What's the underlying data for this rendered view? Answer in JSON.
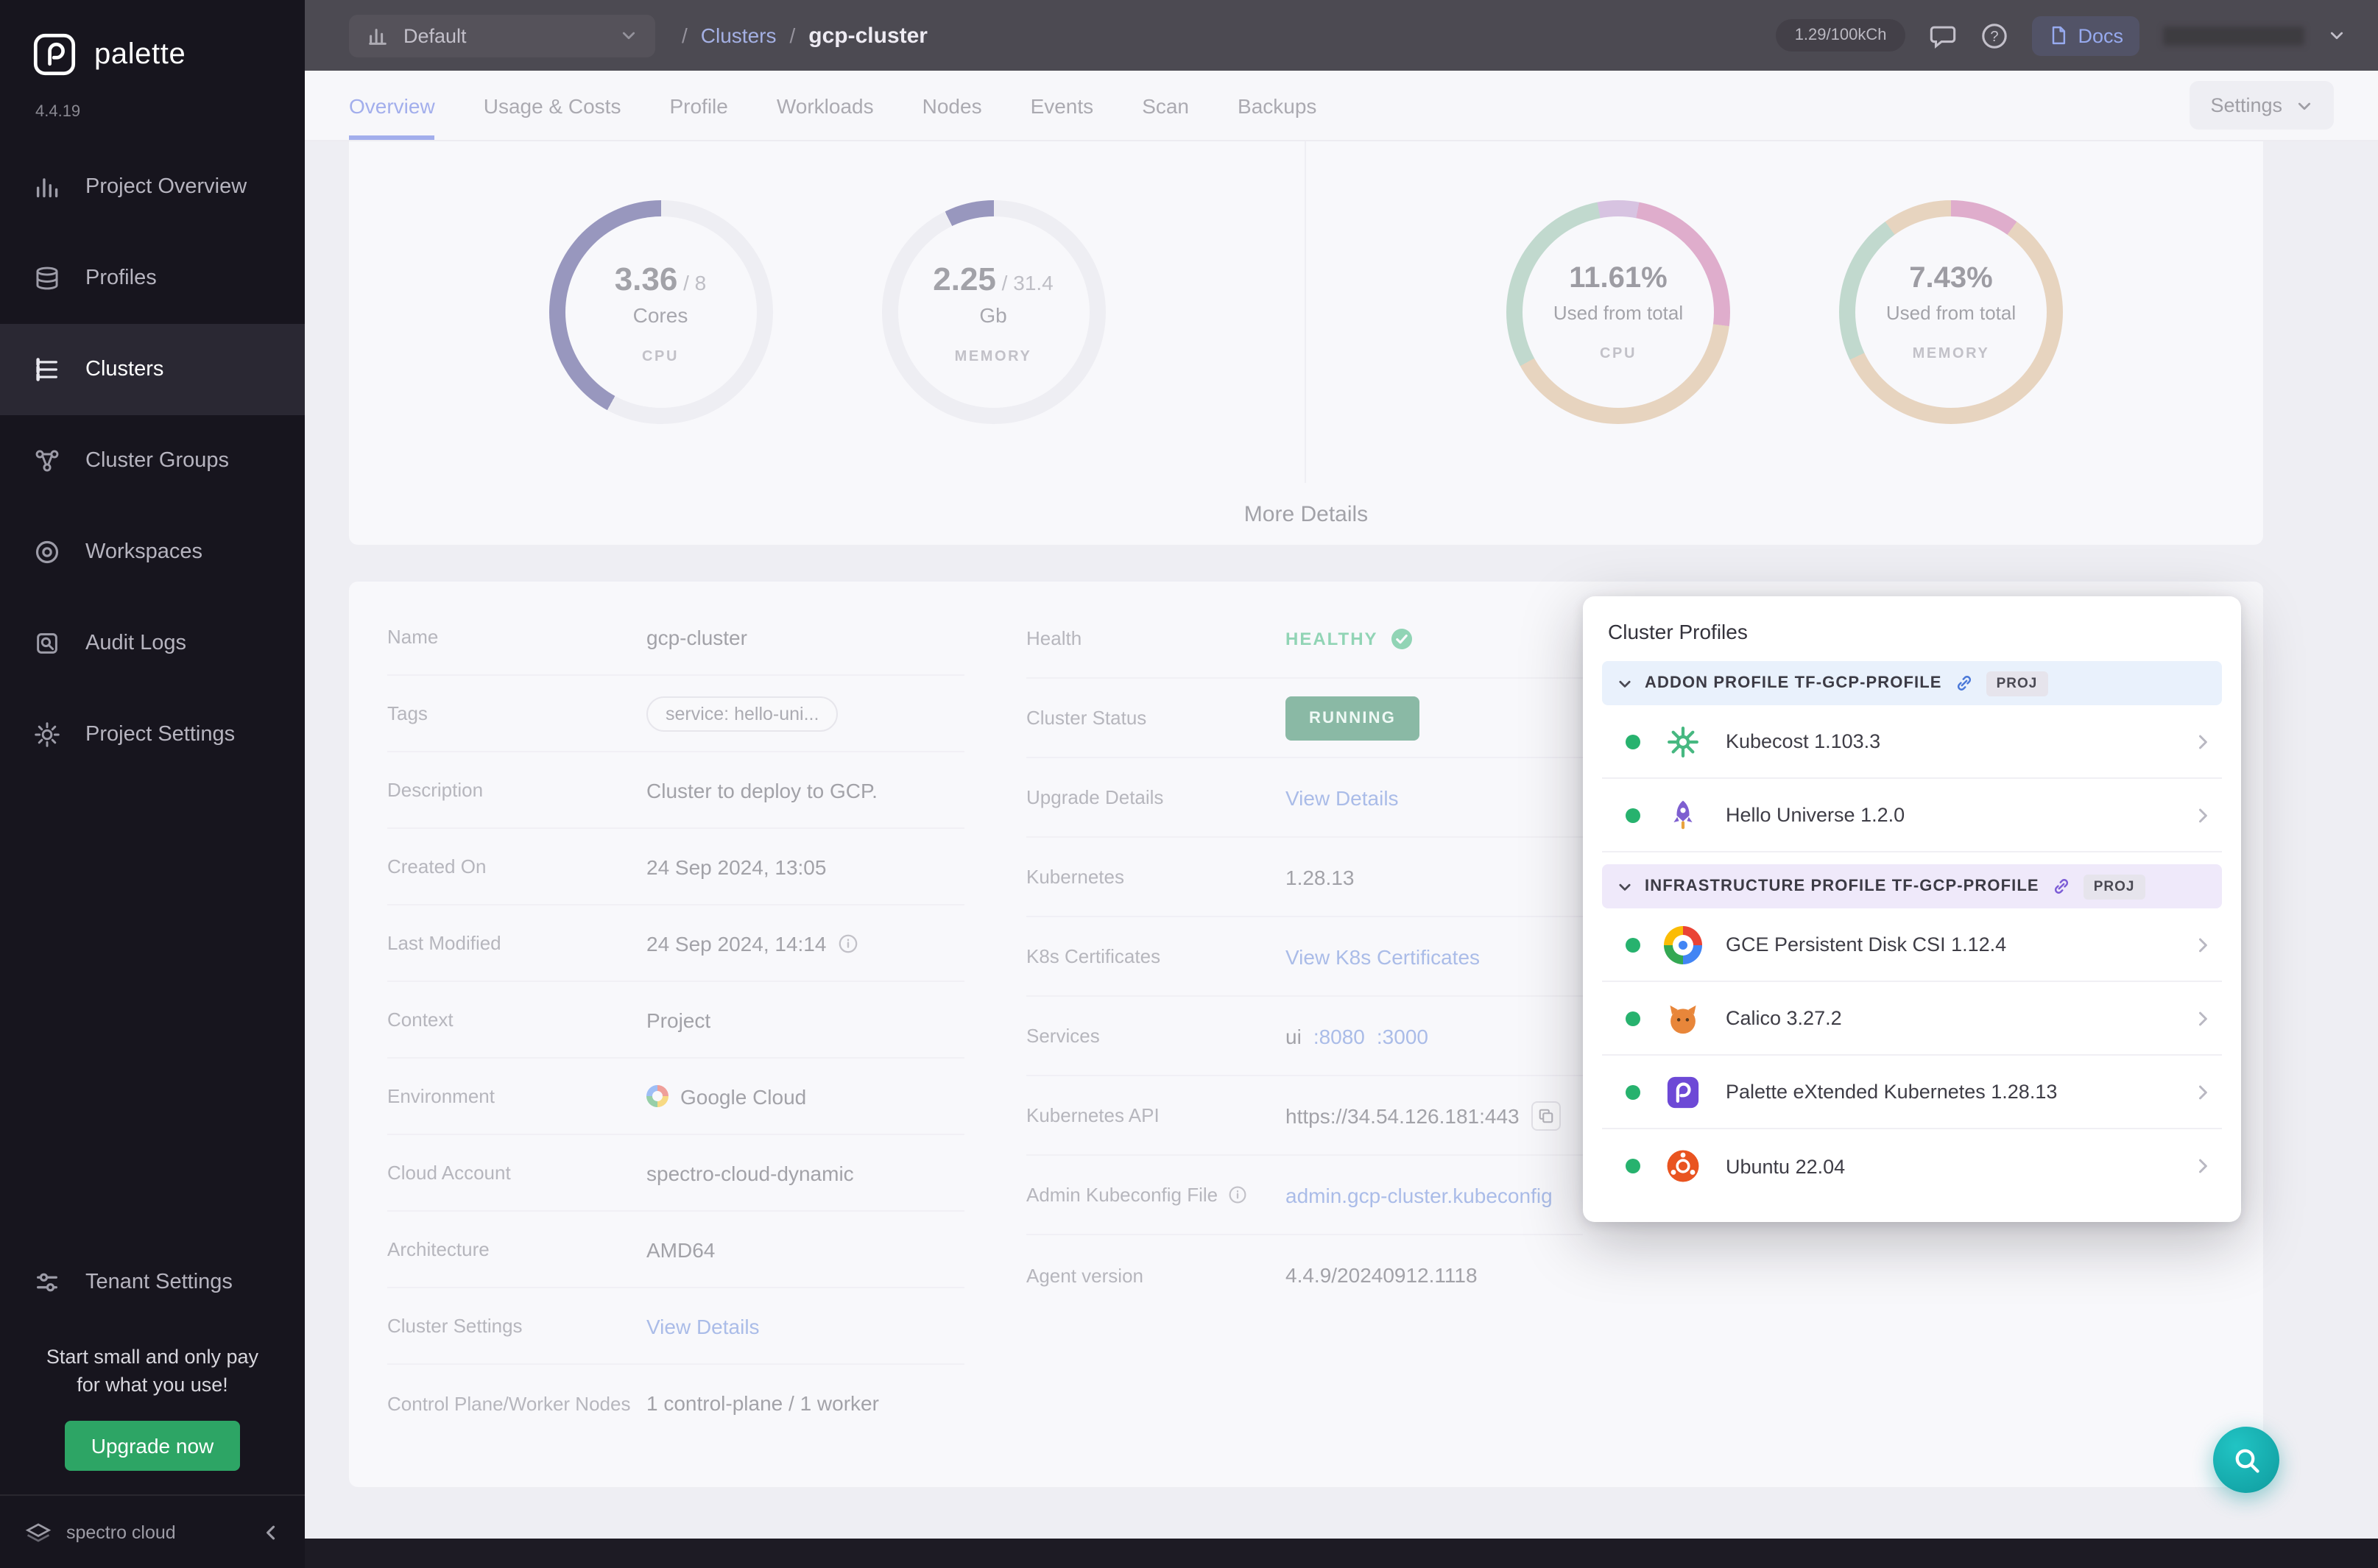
{
  "colors": {
    "accent_blue": "#4a63e0",
    "link_blue": "#5b7fd8",
    "healthy_green": "#27b26e",
    "running_bg": "#17794b",
    "upgrade_green": "#2da565",
    "teal_fab": "#0f9b9e",
    "gauge_arc": "#36327f"
  },
  "sidebar": {
    "logo_text": "palette",
    "version": "4.4.19",
    "items": [
      {
        "label": "Project Overview"
      },
      {
        "label": "Profiles"
      },
      {
        "label": "Clusters"
      },
      {
        "label": "Cluster Groups"
      },
      {
        "label": "Workspaces"
      },
      {
        "label": "Audit Logs"
      },
      {
        "label": "Project Settings"
      }
    ],
    "tenant_settings": "Tenant Settings",
    "promo_text": "Start small and only pay for what you use!",
    "upgrade_button": "Upgrade now",
    "brand": "spectro cloud"
  },
  "topbar": {
    "project_selector": "Default",
    "breadcrumb": {
      "sep": "/",
      "parent": "Clusters",
      "current": "gcp-cluster"
    },
    "usage_pill": "1.29/100kCh",
    "docs_label": "Docs"
  },
  "tabs": {
    "items": [
      {
        "label": "Overview"
      },
      {
        "label": "Usage & Costs"
      },
      {
        "label": "Profile"
      },
      {
        "label": "Workloads"
      },
      {
        "label": "Nodes"
      },
      {
        "label": "Events"
      },
      {
        "label": "Scan"
      },
      {
        "label": "Backups"
      }
    ],
    "settings_button": "Settings"
  },
  "metrics": {
    "cpu_gauge": {
      "value": "3.36",
      "total": " / 8",
      "unit": "Cores",
      "label": "CPU",
      "fraction": 0.42
    },
    "memory_gauge": {
      "value": "2.25",
      "total": " / 31.4",
      "unit": "Gb",
      "label": "MEMORY",
      "fraction": 0.072
    },
    "cpu_usage": {
      "percent": "11.61%",
      "caption": "Used from total",
      "label": "CPU"
    },
    "memory_usage": {
      "percent": "7.43%",
      "caption": "Used from total",
      "label": "MEMORY"
    },
    "more_details": "More Details"
  },
  "details": {
    "left": {
      "name": {
        "label": "Name",
        "value": "gcp-cluster"
      },
      "tags": {
        "label": "Tags",
        "value": "service: hello-uni..."
      },
      "description": {
        "label": "Description",
        "value": "Cluster to deploy to GCP."
      },
      "created_on": {
        "label": "Created On",
        "value": "24 Sep 2024, 13:05"
      },
      "last_modified": {
        "label": "Last Modified",
        "value": "24 Sep 2024, 14:14"
      },
      "context": {
        "label": "Context",
        "value": "Project"
      },
      "environment": {
        "label": "Environment",
        "value": "Google Cloud"
      },
      "cloud_account": {
        "label": "Cloud Account",
        "value": "spectro-cloud-dynamic"
      },
      "architecture": {
        "label": "Architecture",
        "value": "AMD64"
      },
      "cluster_settings": {
        "label": "Cluster Settings",
        "value": "View Details"
      },
      "nodes": {
        "label": "Control Plane/Worker Nodes",
        "value": "1 control-plane / 1 worker"
      }
    },
    "right": {
      "health": {
        "label": "Health",
        "value": "HEALTHY"
      },
      "cluster_status": {
        "label": "Cluster Status",
        "value": "RUNNING"
      },
      "upgrade_details": {
        "label": "Upgrade Details",
        "value": "View Details"
      },
      "kubernetes": {
        "label": "Kubernetes",
        "value": "1.28.13"
      },
      "k8s_certificates": {
        "label": "K8s Certificates",
        "value": "View K8s Certificates"
      },
      "services": {
        "label": "Services",
        "value": "ui",
        "link1": ":8080",
        "link2": ":3000"
      },
      "kubernetes_api": {
        "label": "Kubernetes API",
        "value": "https://34.54.126.181:443"
      },
      "kubeconfig": {
        "label": "Admin Kubeconfig File",
        "value": "admin.gcp-cluster.kubeconfig"
      },
      "agent_version": {
        "label": "Agent version",
        "value": "4.4.9/20240912.1118"
      }
    }
  },
  "cluster_profiles": {
    "title": "Cluster Profiles",
    "sections": [
      {
        "name": "ADDON PROFILE TF-GCP-PROFILE",
        "badge": "PROJ",
        "items": [
          {
            "name": "Kubecost 1.103.3"
          },
          {
            "name": "Hello Universe 1.2.0"
          }
        ]
      },
      {
        "name": "INFRASTRUCTURE PROFILE TF-GCP-PROFILE",
        "badge": "PROJ",
        "items": [
          {
            "name": "GCE Persistent Disk CSI 1.12.4"
          },
          {
            "name": "Calico 3.27.2"
          },
          {
            "name": "Palette eXtended Kubernetes 1.28.13"
          },
          {
            "name": "Ubuntu 22.04"
          }
        ]
      }
    ]
  }
}
